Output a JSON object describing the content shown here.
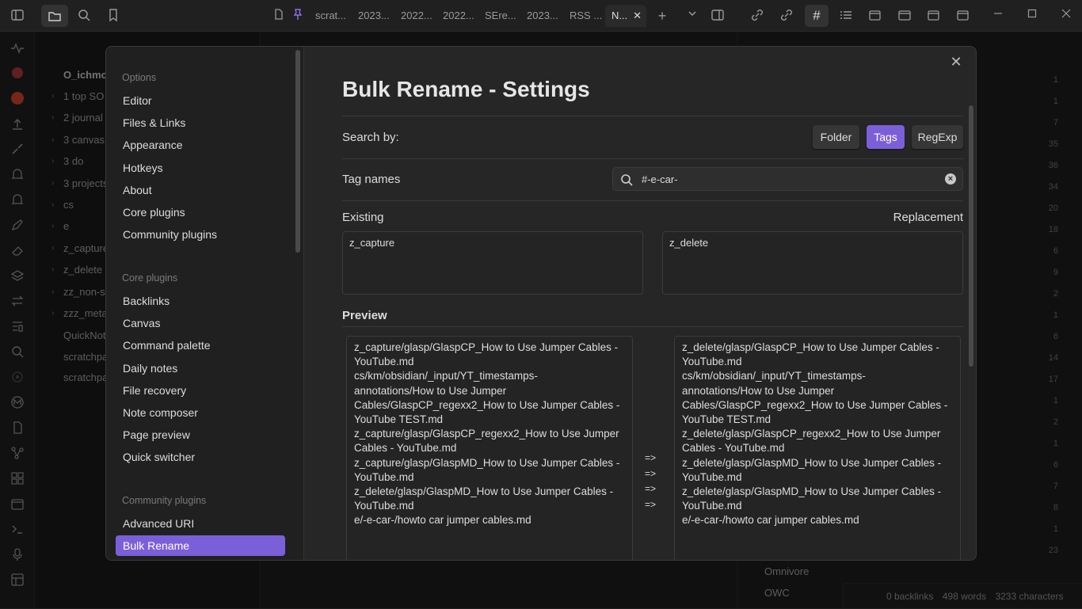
{
  "topbar": {
    "tabs": [
      {
        "label": "scrat..."
      },
      {
        "label": "2023..."
      },
      {
        "label": "2022..."
      },
      {
        "label": "2022..."
      },
      {
        "label": "SEre..."
      },
      {
        "label": "2023..."
      },
      {
        "label": "RSS ..."
      },
      {
        "label": "N..."
      }
    ],
    "new_tab_title": "New tab"
  },
  "explorer": {
    "vault_name": "O_ichmo",
    "items": [
      {
        "label": "1 top SO",
        "folder": true
      },
      {
        "label": "2 journal",
        "folder": true
      },
      {
        "label": "3 canvas",
        "folder": true
      },
      {
        "label": "3 do",
        "folder": true
      },
      {
        "label": "3 projects",
        "folder": true
      },
      {
        "label": "cs",
        "folder": true
      },
      {
        "label": "e",
        "folder": true
      },
      {
        "label": "z_capture",
        "folder": true
      },
      {
        "label": "z_delete",
        "folder": true
      },
      {
        "label": "zz_non-st",
        "folder": true
      },
      {
        "label": "zzz_meta",
        "folder": true
      },
      {
        "label": "QuickNot",
        "folder": false
      },
      {
        "label": "scratchpa",
        "folder": false
      },
      {
        "label": "scratchpa",
        "folder": false
      }
    ]
  },
  "rightpane": {
    "counts": [
      "1",
      "1",
      "7",
      "35",
      "36",
      "34",
      "20",
      "18",
      "6",
      "9",
      "2",
      "1",
      "6",
      "14",
      "17",
      "1",
      "2",
      "1",
      "6",
      "7",
      "8",
      "1",
      "23"
    ],
    "names": [
      "Omnivore",
      "OWC"
    ]
  },
  "statusbar": {
    "backlinks": "0 backlinks",
    "words": "498 words",
    "characters": "3233 characters"
  },
  "settings": {
    "options_heading": "Options",
    "options_items": [
      "Editor",
      "Files & Links",
      "Appearance",
      "Hotkeys",
      "About",
      "Core plugins",
      "Community plugins"
    ],
    "core_heading": "Core plugins",
    "core_items": [
      "Backlinks",
      "Canvas",
      "Command palette",
      "Daily notes",
      "File recovery",
      "Note composer",
      "Page preview",
      "Quick switcher"
    ],
    "community_heading": "Community plugins",
    "community_items": [
      "Advanced URI",
      "Bulk Rename"
    ],
    "active_item": "Bulk Rename"
  },
  "plugin": {
    "title": "Bulk Rename - Settings",
    "search_by_label": "Search by:",
    "search_modes": [
      "Folder",
      "Tags",
      "RegExp"
    ],
    "active_mode": "Tags",
    "tag_names_label": "Tag names",
    "tag_names_value": "#-e-car-",
    "existing_label": "Existing",
    "replacement_label": "Replacement",
    "existing_value": "z_capture",
    "replacement_value": "z_delete",
    "preview_label": "Preview",
    "preview_left": [
      "z_capture/glasp/GlaspCP_How to Use Jumper Cables -",
      "YouTube.md",
      "cs/km/obsidian/_input/YT_timestamps-",
      "annotations/How to Use Jumper",
      "Cables/GlaspCP_regexx2_How to Use Jumper Cables -",
      "YouTube TEST.md",
      "z_capture/glasp/GlaspCP_regexx2_How to Use Jumper",
      "Cables - YouTube.md",
      "z_capture/glasp/GlaspMD_How to Use Jumper Cables -",
      "YouTube.md",
      "z_delete/glasp/GlaspMD_How to Use Jumper Cables -",
      "YouTube.md",
      "e/-e-car-/howto car jumper cables.md"
    ],
    "preview_right": [
      "z_delete/glasp/GlaspCP_How to Use Jumper Cables -",
      "YouTube.md",
      "cs/km/obsidian/_input/YT_timestamps-",
      "annotations/How to Use Jumper",
      "Cables/GlaspCP_regexx2_How to Use Jumper Cables -",
      "YouTube TEST.md",
      "z_delete/glasp/GlaspCP_regexx2_How to Use Jumper",
      "Cables - YouTube.md",
      "z_delete/glasp/GlaspMD_How to Use Jumper Cables -",
      "YouTube.md",
      "z_delete/glasp/GlaspMD_How to Use Jumper Cables -",
      "YouTube.md",
      "e/-e-car-/howto car jumper cables.md"
    ],
    "arrows": [
      "=>",
      "=>",
      "=>",
      "=>"
    ]
  },
  "colors": {
    "accent": "#7b5fd9",
    "background": "#1e1e1e",
    "modal": "#262626"
  }
}
